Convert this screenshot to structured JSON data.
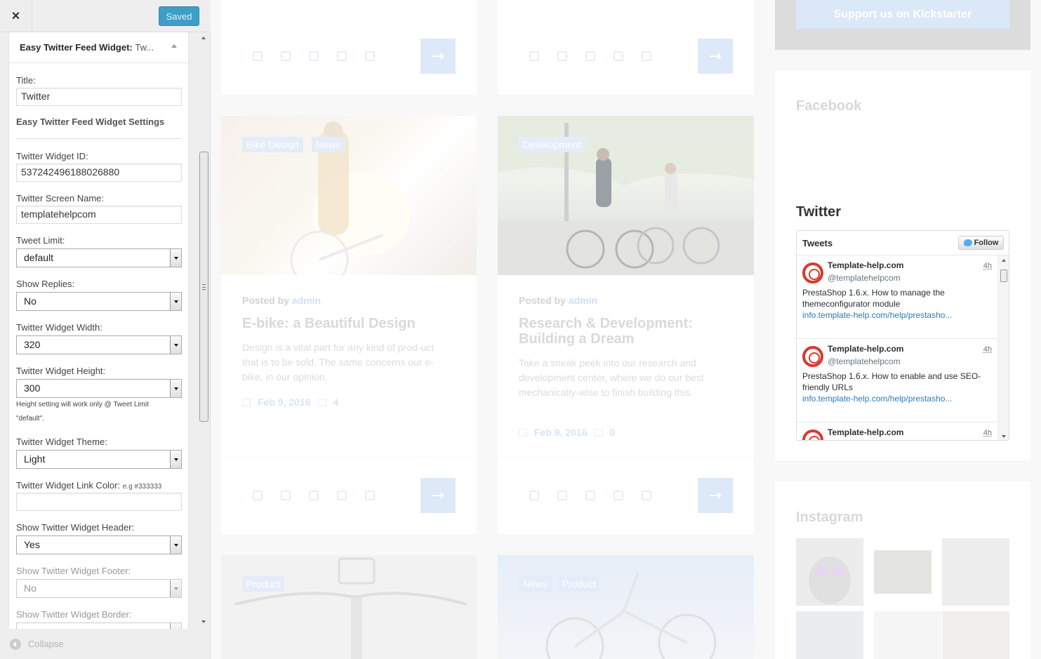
{
  "sidebar": {
    "close_label": "×",
    "saved_label": "Saved",
    "panel_title": "Easy Twitter Feed Widget:",
    "panel_title_suffix": "Tw...",
    "title_label": "Title:",
    "title_value": "Twitter",
    "settings_heading": "Easy Twitter Feed Widget Settings",
    "widget_id_label": "Twitter Widget ID:",
    "widget_id_value": "537242496188026880",
    "screen_name_label": "Twitter Screen Name:",
    "screen_name_value": "templatehelpcom",
    "tweet_limit_label": "Tweet Limit:",
    "tweet_limit_value": "default",
    "show_replies_label": "Show Replies:",
    "show_replies_value": "No",
    "width_label": "Twitter Widget Width:",
    "width_value": "320",
    "height_label": "Twitter Widget Height:",
    "height_value": "300",
    "height_note": "Height setting will work only @ Tweet Limit \"default\".",
    "theme_label": "Twitter Widget Theme:",
    "theme_value": "Light",
    "link_color_label": "Twitter Widget Link Color:",
    "link_color_hint": "e.g #333333",
    "link_color_value": "",
    "show_header_label": "Show Twitter Widget Header:",
    "show_header_value": "Yes",
    "show_footer_label": "Show Twitter Widget Footer:",
    "show_footer_value": "No",
    "show_border_label": "Show Twitter Widget Border:",
    "collapse_label": "Collapse"
  },
  "preview": {
    "kickstarter_button": "Support us on Kickstarter",
    "posts": [
      {
        "tags": [
          "Bike Design",
          "News"
        ],
        "posted_by": "Posted by",
        "author": "admin",
        "title": "E-bike: a Beautiful Design",
        "excerpt": "Design is a vital part for any kind of prod-uct that is to be sold. The same concerns our e-bike, in our opinion.",
        "date": "Feb 9, 2016",
        "comments": "4"
      },
      {
        "tags": [
          "Development"
        ],
        "posted_by": "Posted by",
        "author": "admin",
        "title": "Research & Development: Building a Dream",
        "excerpt": "Take a sneak peek into our research and development center, where we do our best mechanically-wise to finish building this.",
        "date": "Feb 9, 2016",
        "comments": "0"
      }
    ],
    "bottom_tags_left": [
      "Product"
    ],
    "bottom_tags_right": [
      "News",
      "Product"
    ],
    "facebook_title": "Facebook",
    "twitter_title": "Twitter",
    "instagram_title": "Instagram",
    "twitter_widget": {
      "header": "Tweets",
      "follow_label": "Follow",
      "tweets": [
        {
          "name": "Template-help.com",
          "handle": "@templatehelpcom",
          "time": "4h",
          "text": "PrestaShop 1.6.x. How to manage the themeconfigurator module",
          "link": "info.template-help.com/help/prestasho..."
        },
        {
          "name": "Template-help.com",
          "handle": "@templatehelpcom",
          "time": "4h",
          "text": "PrestaShop 1.6.x. How to enable and use SEO-friendly URLs",
          "link": "info.template-help.com/help/prestasho..."
        },
        {
          "name": "Template-help.com",
          "handle": "",
          "time": "4h",
          "text": "",
          "link": ""
        }
      ]
    }
  }
}
